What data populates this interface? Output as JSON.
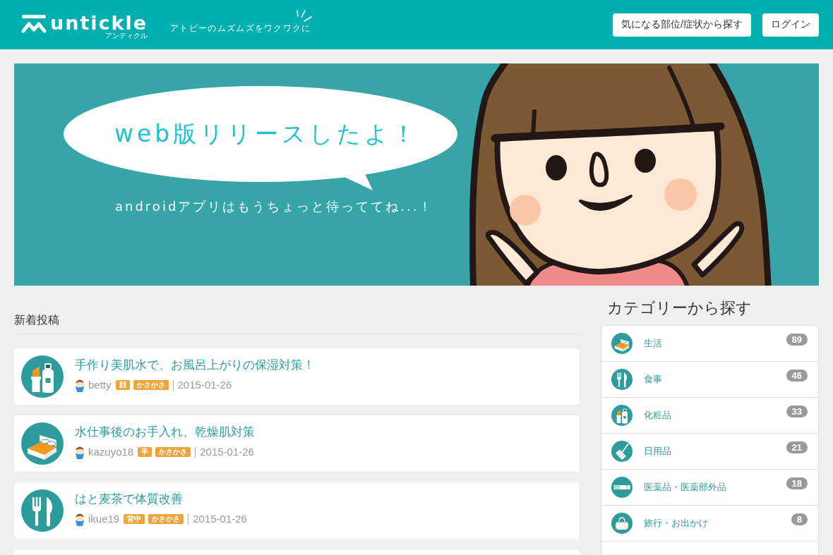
{
  "header": {
    "logo": "untickle",
    "logo_reading": "アンティクル",
    "tagline": "アトピーのムズムズをワクワクに",
    "buttons": [
      {
        "label": "気になる部位/症状から探す"
      },
      {
        "label": "ログイン"
      }
    ]
  },
  "banner": {
    "headline": "web版リリースしたよ！",
    "subline": "androidアプリはもうちょっと待っててね...！"
  },
  "new_posts": {
    "heading": "新着投稿",
    "items": [
      {
        "kind": "cosmetics",
        "title": "手作り美肌水で、お風呂上がりの保湿対策！",
        "user": "betty",
        "tags": [
          "顔",
          "かさかさ"
        ],
        "date": "2015-01-26"
      },
      {
        "kind": "bed",
        "title": "水仕事後のお手入れ、乾燥肌対策",
        "user": "kazuyo18",
        "tags": [
          "手",
          "かさかさ"
        ],
        "date": "2015-01-26"
      },
      {
        "kind": "cutlery",
        "title": "はと麦茶で体質改善",
        "user": "ikue19",
        "tags": [
          "背中",
          "かさかさ"
        ],
        "date": "2015-01-26"
      }
    ]
  },
  "categories": {
    "heading": "カテゴリーから探す",
    "items": [
      {
        "kind": "bed",
        "label": "生活",
        "count": "89"
      },
      {
        "kind": "cutlery",
        "label": "食事",
        "count": "46"
      },
      {
        "kind": "cosmetics",
        "label": "化粧品",
        "count": "33"
      },
      {
        "kind": "roller",
        "label": "日用品",
        "count": "21"
      },
      {
        "kind": "tube",
        "label": "医薬品・医薬部外品",
        "count": "18"
      },
      {
        "kind": "bag",
        "label": "旅行・お出かけ",
        "count": "8"
      }
    ]
  }
}
